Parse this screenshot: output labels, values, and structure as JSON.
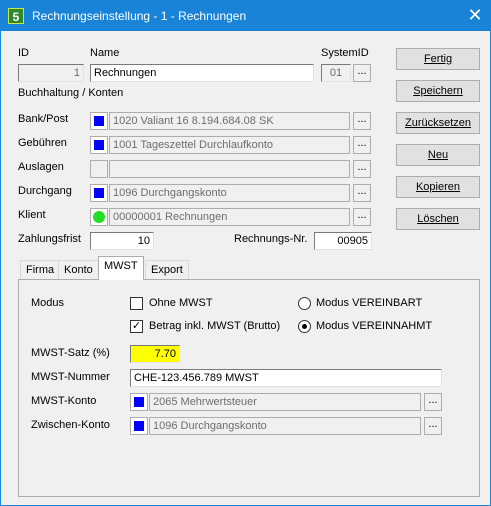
{
  "window": {
    "icon_text": "5",
    "title": "Rechnungseinstellung - 1 -  Rechnungen",
    "close_glyph": "✕"
  },
  "header": {
    "id_label": "ID",
    "id_value": "1",
    "name_label": "Name",
    "name_value": "Rechnungen",
    "system_label": "SystemID",
    "system_value": "01",
    "dots": "..."
  },
  "accounts": {
    "section_label": "Buchhaltung / Konten",
    "rows": [
      {
        "label": "Bank/Post",
        "value": "1020 Valiant 16 8.194.684.08 SK",
        "swatch": "blue"
      },
      {
        "label": "Gebühren",
        "value": "1001 Tageszettel Durchlaufkonto",
        "swatch": "blue"
      },
      {
        "label": "Auslagen",
        "value": "",
        "swatch": "none"
      },
      {
        "label": "Durchgang",
        "value": "1096 Durchgangskonto",
        "swatch": "blue"
      },
      {
        "label": "Klient",
        "value": "00000001 Rechnungen",
        "swatch": "green"
      }
    ]
  },
  "payment": {
    "term_label": "Zahlungsfrist",
    "term_value": "10",
    "invoice_no_label": "Rechnungs-Nr.",
    "invoice_no_value": "00905"
  },
  "buttons": [
    "Fertig",
    "Speichern",
    "Zurücksetzen",
    "Neu",
    "Kopieren",
    "Löschen"
  ],
  "tabs": [
    "Firma",
    "Konto",
    "MWST",
    "Export"
  ],
  "mwst": {
    "modus_label": "Modus",
    "ohne_label": "Ohne MWST",
    "ohne_checked": false,
    "brutto_label": "Betrag inkl. MWST (Brutto)",
    "brutto_checked": true,
    "vereinbart_label": "Modus VEREINBART",
    "vereinnahmt_label": "Modus VEREINNAHMT",
    "selected_mode": "VEREINNAHMT",
    "satz_label": "MWST-Satz (%)",
    "satz_value": "7.70",
    "nummer_label": "MWST-Nummer",
    "nummer_value": "CHE-123.456.789 MWST",
    "konto_label": "MWST-Konto",
    "konto_value": "2065 Mehrwertsteuer",
    "zwischen_label": "Zwischen-Konto",
    "zwischen_value": "1096 Durchgangskonto"
  },
  "colors": {
    "titlebar": "#1883d7",
    "swatch_blue": "#0000ff",
    "swatch_green": "#22dd22",
    "highlight_yellow": "#ffff00"
  }
}
